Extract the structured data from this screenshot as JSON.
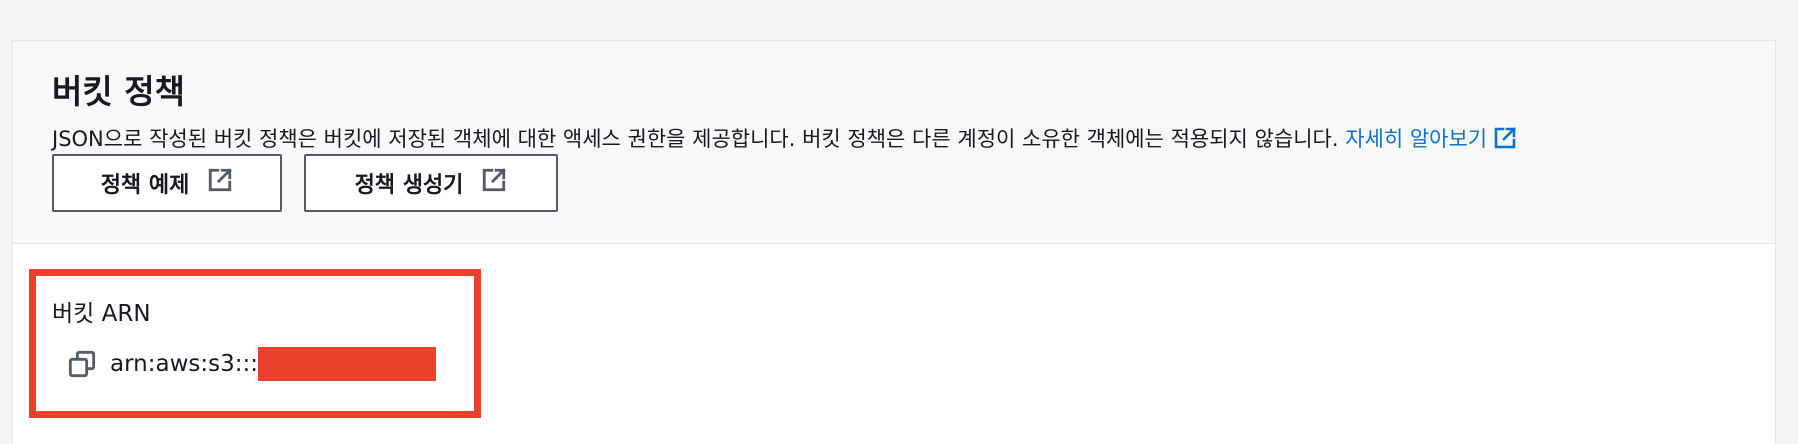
{
  "bucket_policy": {
    "title": "버킷 정책",
    "description": "JSON으로 작성된 버킷 정책은 버킷에 저장된 객체에 대한 액세스 권한을 제공합니다. 버킷 정책은 다른 계정이 소유한 객체에는 적용되지 않습니다.",
    "learn_more_label": "자세히 알아보기",
    "buttons": {
      "policy_examples_label": "정책 예제",
      "policy_generator_label": "정책 생성기"
    }
  },
  "bucket_arn": {
    "label": "버킷 ARN",
    "value_prefix": "arn:aws:s3:::",
    "value_redacted": true
  },
  "icons": {
    "external_link": "external-link-icon",
    "copy": "copy-icon"
  },
  "colors": {
    "link": "#0972d3",
    "highlight_border": "#e8412c",
    "redaction": "#e8412c",
    "button_border": "#545b64",
    "page_background": "#f2f3f3",
    "header_background": "#f8f8f8"
  }
}
